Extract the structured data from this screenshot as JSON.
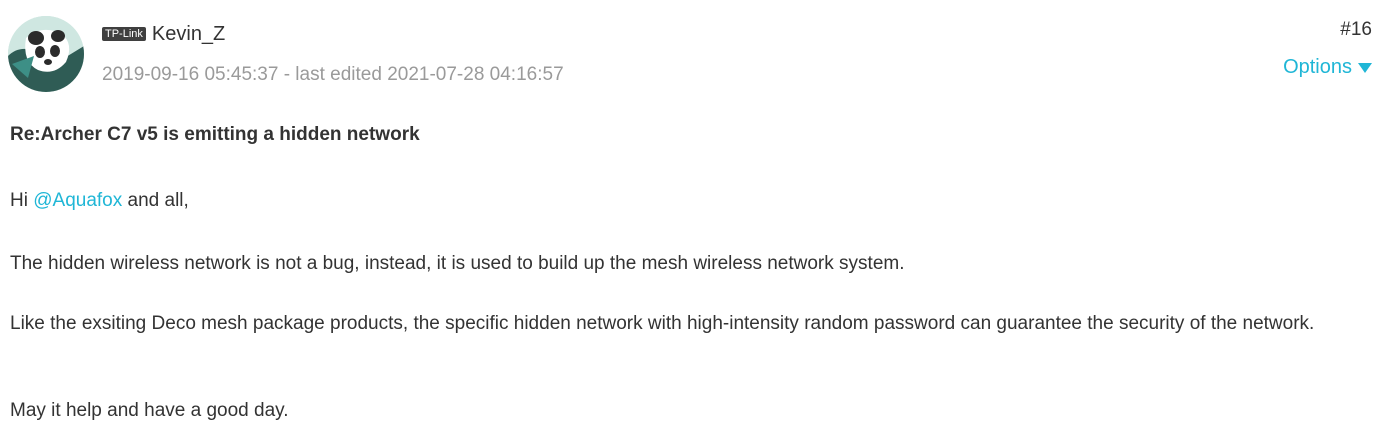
{
  "post": {
    "author": {
      "badge": "TP-Link",
      "name": "Kevin_Z",
      "avatar_icon": "panda-avatar-icon"
    },
    "meta": "2019-09-16 05:45:37 - last edited 2021-07-28 04:16:57",
    "number": "#16",
    "options_label": "Options",
    "options_icon": "caret-down-icon",
    "subject": "Re:Archer C7 v5 is emitting a hidden network",
    "greeting": {
      "prefix": "Hi ",
      "mention": "@Aquafox",
      "suffix": " and all,"
    },
    "paragraphs": [
      "The hidden wireless network is not a bug, instead, it is used to build up the mesh wireless network system.",
      "Like the exsiting Deco mesh package products, the specific hidden network with high-intensity random password can guarantee the security of the network.",
      "May it help and have a good day."
    ]
  },
  "colors": {
    "accent": "#1fb6d6",
    "text": "#333333",
    "meta": "#9a9a9a",
    "badge_bg": "#3f3f3f",
    "avatar_bg": "#cfe7e1"
  }
}
